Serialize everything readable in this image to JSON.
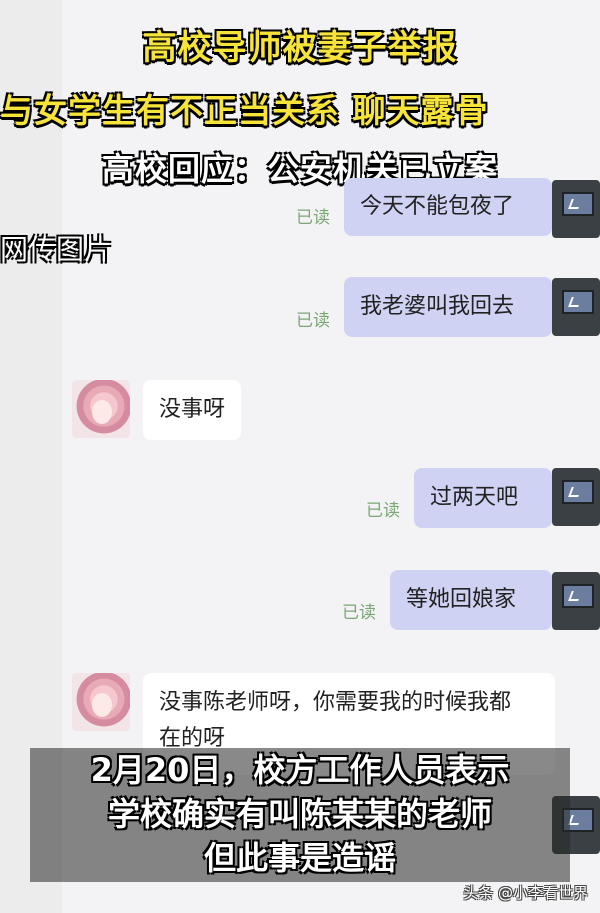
{
  "headline": {
    "line1": "高校导师被妻子举报",
    "line2": "与女学生有不正当关系 聊天露骨",
    "line3": "高校回应：公安机关已立案"
  },
  "overlay_label": "网传图片",
  "chat": {
    "read_label": "已读",
    "messages": [
      {
        "from": "me",
        "text": "今天不能包夜了"
      },
      {
        "from": "me",
        "text": "我老婆叫我回去"
      },
      {
        "from": "her",
        "text": "没事呀"
      },
      {
        "from": "me",
        "text": "过两天吧"
      },
      {
        "from": "me",
        "text": "等她回娘家"
      },
      {
        "from": "her",
        "text_line1": "没事陈老师呀，你需要我的时候我都",
        "text_line2": "在的呀"
      }
    ]
  },
  "caption": {
    "line1": "2月20日，校方工作人员表示",
    "line2": "学校确实有叫陈某某的老师",
    "line3": "但此事是造谣"
  },
  "footer": {
    "source": "头条 @小李看世界"
  }
}
